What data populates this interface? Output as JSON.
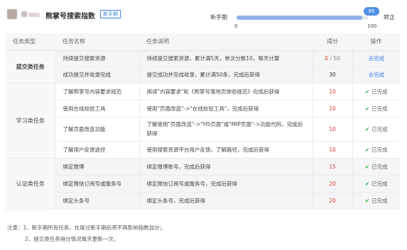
{
  "header": {
    "title": "熊掌号搜索指数",
    "badge": "新手期"
  },
  "progress": {
    "start_label": "新手期",
    "end_label": "转正",
    "value": 95,
    "min_label": "0",
    "max_label": "100",
    "percent": 95
  },
  "table": {
    "headers": [
      "任务类型",
      "任务名称",
      "任务说明",
      "得分",
      "操作"
    ],
    "categories": [
      "提交类任务",
      "学习类任务",
      "认证类任务"
    ],
    "rows": [
      {
        "name": "持续提交搜索资源",
        "desc": "持续提交搜索资源，累计满5天，单次分数10，每天计算",
        "score": "0",
        "score_total": "/ 50",
        "action": "去完成"
      },
      {
        "name": "成功提交并收录完成",
        "desc": "提交成功并完成收录，累计满50条，完成后获得",
        "score": "30",
        "action": "去完成"
      },
      {
        "name": "了解熊掌号内容要求规范",
        "desc": "阅读\"内容要求\"和《熊掌号落地页体验规范》完成后获得",
        "score": "10",
        "action": "已完成"
      },
      {
        "name": "使用在线校验工具",
        "desc": "使用\"页面改造\"->\"在线校验工具\"，完成后获得",
        "score": "10",
        "action": "已完成"
      },
      {
        "name": "了解页面改造功能",
        "desc": "了解使用\"页面改造\"->\"H5页面\"或\"MIP页面\"->功能代码，完成后获得",
        "score": "10",
        "action": "已完成"
      },
      {
        "name": "了解用户反馈途径",
        "desc": "使用搜索资源平台用户反馈，了解路径，完成后获得",
        "score": "10",
        "action": "已完成"
      },
      {
        "name": "绑定微博",
        "desc": "绑定微博账号，完成后获得",
        "score": "15",
        "action": "已完成"
      },
      {
        "name": "绑定微信订阅号或服务号",
        "desc": "绑定微信订阅号或服务号，完成后获得",
        "score": "20",
        "action": "已完成"
      },
      {
        "name": "绑定头条号",
        "desc": "绑定头条号，完成后获得",
        "score": "20",
        "action": "已完成"
      }
    ]
  },
  "notes": {
    "line1": "注意：1、新手期所有任务，在度过新手期后将不再影响指数加分；",
    "line2": "2、提交类任务得分情况每天更新一次。"
  },
  "colors": {
    "accent": "#3c7fe0",
    "score_red": "#e03c31",
    "check_green": "#22a045",
    "progress_fill": "#8fb1e6"
  },
  "icons": {
    "done": "check-icon"
  }
}
